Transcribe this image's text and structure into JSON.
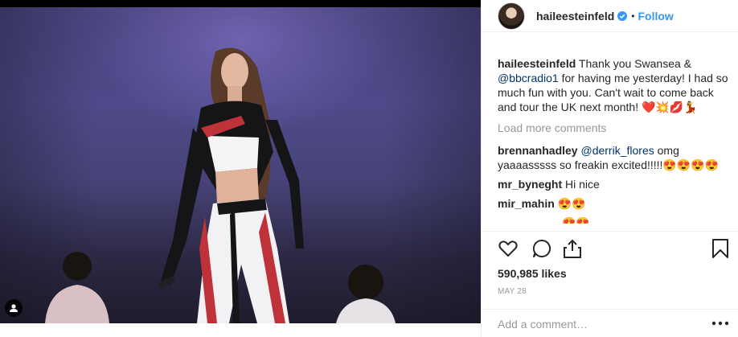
{
  "post": {
    "username": "haileesteinfeld",
    "follow_label": "Follow",
    "dot": "•",
    "caption_text": "Thank you Swansea & ",
    "caption_mention": "@bbcradio1",
    "caption_rest": " for having me yesterday! I had so much fun with you. Can't wait to come back and tour the UK next month! ❤️💥💋💃",
    "load_more": "Load more comments",
    "likes": "590,985 likes",
    "date": "MAY 28",
    "add_comment_placeholder": "Add a comment…"
  },
  "comments": [
    {
      "user": "brennanhadley",
      "mention": "@derrik_flores",
      "text": " omg yaaaasssss so freakin excited!!!!!😍😍😍😍"
    },
    {
      "user": "mr_byneght",
      "mention": "",
      "text": " Hi nice"
    },
    {
      "user": "mir_mahin",
      "mention": "",
      "text": " 😍😍"
    },
    {
      "user": "",
      "mention": "",
      "text": "😍😍"
    }
  ],
  "colors": {
    "link": "#3897f0",
    "mention": "#003569",
    "muted": "#999999",
    "verified": "#3897f0"
  },
  "icons": [
    "verified-badge-icon",
    "heart-icon",
    "comment-icon",
    "share-icon",
    "bookmark-icon",
    "user-tag-icon",
    "more-options-icon"
  ]
}
